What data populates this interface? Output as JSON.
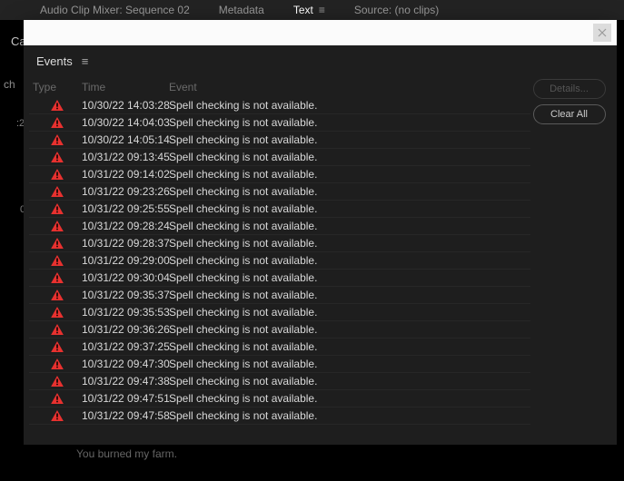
{
  "bg_tabs": {
    "t0": "Audio Clip Mixer: Sequence 02",
    "t1": "Metadata",
    "t2": "Text",
    "t3": "Source: (no clips)"
  },
  "bg": {
    "caption": "Cap",
    "ch": "ch",
    "time1": ":2",
    "time2": "0",
    "burned": "You burned my farm."
  },
  "events": {
    "title": "Events",
    "headers": {
      "type": "Type",
      "time": "Time",
      "event": "Event"
    },
    "buttons": {
      "details": "Details...",
      "clear": "Clear All"
    },
    "rows": [
      {
        "time": "10/30/22 14:03:28",
        "msg": "Spell checking is not available."
      },
      {
        "time": "10/30/22 14:04:03",
        "msg": "Spell checking is not available."
      },
      {
        "time": "10/30/22 14:05:14",
        "msg": "Spell checking is not available."
      },
      {
        "time": "10/31/22 09:13:45",
        "msg": "Spell checking is not available."
      },
      {
        "time": "10/31/22 09:14:02",
        "msg": "Spell checking is not available."
      },
      {
        "time": "10/31/22 09:23:26",
        "msg": "Spell checking is not available."
      },
      {
        "time": "10/31/22 09:25:55",
        "msg": "Spell checking is not available."
      },
      {
        "time": "10/31/22 09:28:24",
        "msg": "Spell checking is not available."
      },
      {
        "time": "10/31/22 09:28:37",
        "msg": "Spell checking is not available."
      },
      {
        "time": "10/31/22 09:29:00",
        "msg": "Spell checking is not available."
      },
      {
        "time": "10/31/22 09:30:04",
        "msg": "Spell checking is not available."
      },
      {
        "time": "10/31/22 09:35:37",
        "msg": "Spell checking is not available."
      },
      {
        "time": "10/31/22 09:35:53",
        "msg": "Spell checking is not available."
      },
      {
        "time": "10/31/22 09:36:26",
        "msg": "Spell checking is not available."
      },
      {
        "time": "10/31/22 09:37:25",
        "msg": "Spell checking is not available."
      },
      {
        "time": "10/31/22 09:47:30",
        "msg": "Spell checking is not available."
      },
      {
        "time": "10/31/22 09:47:38",
        "msg": "Spell checking is not available."
      },
      {
        "time": "10/31/22 09:47:51",
        "msg": "Spell checking is not available."
      },
      {
        "time": "10/31/22 09:47:58",
        "msg": "Spell checking is not available."
      }
    ]
  }
}
